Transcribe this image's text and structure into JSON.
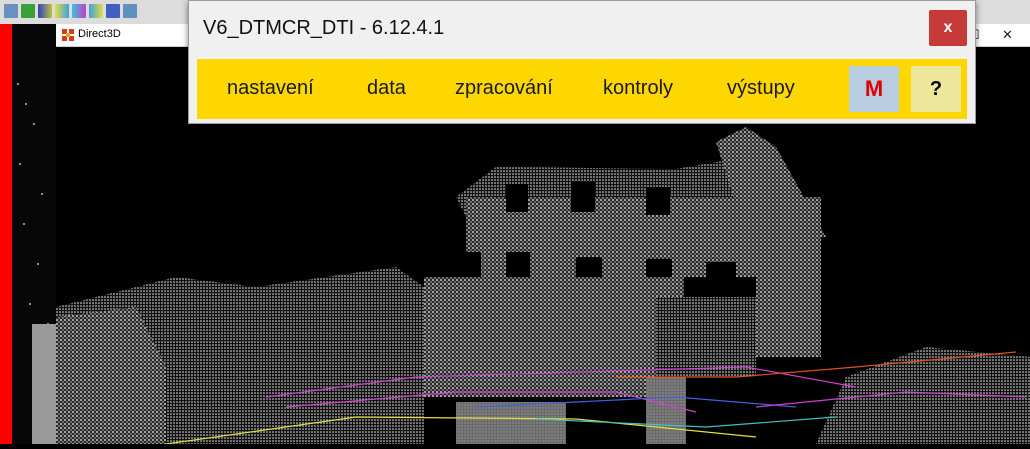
{
  "dialog": {
    "title": "V6_DTMCR_DTI - 6.12.4.1",
    "close_label": "x",
    "menu": {
      "items": [
        "nastavení",
        "data",
        "zpracování",
        "kontroly",
        "výstupy"
      ],
      "m_label": "M",
      "help_label": "?"
    },
    "colors": {
      "menu_bg": "#ffd700",
      "close_bg": "#c73a3a",
      "m_color": "#e00000"
    }
  },
  "d3d_window": {
    "title": "Direct3D",
    "minimize_icon": "minimize-icon",
    "close_icon": "close-icon"
  },
  "host": {
    "maximize_glyph": "☐",
    "close_glyph": "✕"
  }
}
